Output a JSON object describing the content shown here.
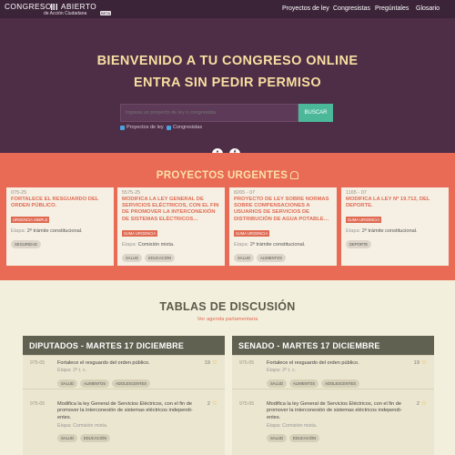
{
  "nav": {
    "logo": {
      "line1a": "CONGRESO",
      "line1b": "ABIERTO",
      "line2": "de Acción Ciudadana",
      "beta": "BETA"
    },
    "menu": [
      "Proyectos de ley",
      "Congresistas",
      "Pregúntales",
      "Glosario"
    ]
  },
  "hero": {
    "title1": "BIENVENIDO A TU CONGRESO ONLINE",
    "title2": "ENTRA SIN PEDIR PERMISO",
    "search_placeholder": "Ingresa un proyecto de ley o congresista",
    "search_button": "BUSCAR",
    "checkbox1": "Proyectos de ley",
    "checkbox2": "Congresistas",
    "social": {
      "twitter": "t",
      "facebook": "f"
    }
  },
  "urgent": {
    "title": "PROYECTOS URGENTES",
    "cards": [
      {
        "code": "075-25",
        "title": "FORTALECE EL RESGUARDO DEL ORDEN PÚBLICO.",
        "badge": "URGENCIA SIMPLE",
        "stage_label": "Etapa:",
        "stage": "2º trámite constitucional.",
        "tags": [
          "SEGURIDAD"
        ]
      },
      {
        "code": "5575-25",
        "title": "MODIFICA LA LEY GENERAL DE SERVICIOS ELÉCTRICOS, CON EL FIN DE PROMOVER LA INTERCONEXIÓN DE SISTEMAS ELÉCTRICOS…",
        "badge": "SUMA URGENCIA",
        "stage_label": "Etapa:",
        "stage": "Comisión mixta.",
        "tags": [
          "SALUD",
          "EDUCACIÓN"
        ]
      },
      {
        "code": "8265 - 07",
        "title": "PROYECTO DE LEY SOBRE NORMAS SOBRE COMPENSACIONES A USUARIOS DE SERVICIOS DE DISTRIBUCIÓN DE AGUA POTABLE…",
        "badge": "SUMA URGENCIA",
        "stage_label": "Etapa:",
        "stage": "2º trámite constitucional.",
        "tags": [
          "SALUD",
          "ALIMENTOS"
        ]
      },
      {
        "code": "1165 - 07",
        "title": "MODIFICA LA LEY Nº 19.712, DEL DEPORTE.",
        "badge": "SUMA URGENCIA",
        "stage_label": "Etapa:",
        "stage": "2º trámite constitucional.",
        "tags": [
          "DEPORTE"
        ]
      }
    ]
  },
  "tables": {
    "title": "TABLAS DE DISCUSIÓN",
    "link": "Ver agenda parlamentaria",
    "panels": [
      {
        "heading": "DIPUTADOS - MARTES 17 DICIEMBRE",
        "rows": [
          {
            "code": "975-05",
            "title": "Fortalece el resguardo del orden público.",
            "stage": "Etapa: 2º t. c.",
            "count": "19",
            "tags": [
              "SALUD",
              "ALIMENTOS",
              "ADOLESCENTES"
            ]
          },
          {
            "code": "975-05",
            "title": "Modifica la ley General de Servicios Eléctricos, con el fin de promover la interconexión de sistemas eléctricos independi- entes.",
            "stage": "Etapa: Comisión mixta.",
            "count": "2",
            "tags": [
              "SALUD",
              "EDUCACIÓN"
            ]
          }
        ]
      },
      {
        "heading": "SENADO - MARTES 17 DICIEMBRE",
        "rows": [
          {
            "code": "975-05",
            "title": "Fortalece el resguardo del orden público.",
            "stage": "Etapa: 2º t. c.",
            "count": "19",
            "tags": [
              "SALUD",
              "ALIMENTOS",
              "ADOLESCENTES"
            ]
          },
          {
            "code": "975-05",
            "title": "Modifica la ley General de Servicios Eléctricos, con el fin de promover la interconexión de sistemas eléctricos independi- entes.",
            "stage": "Etapa: Comisión mixta.",
            "count": "2",
            "tags": [
              "SALUD",
              "EDUCACIÓN"
            ]
          }
        ]
      }
    ]
  }
}
